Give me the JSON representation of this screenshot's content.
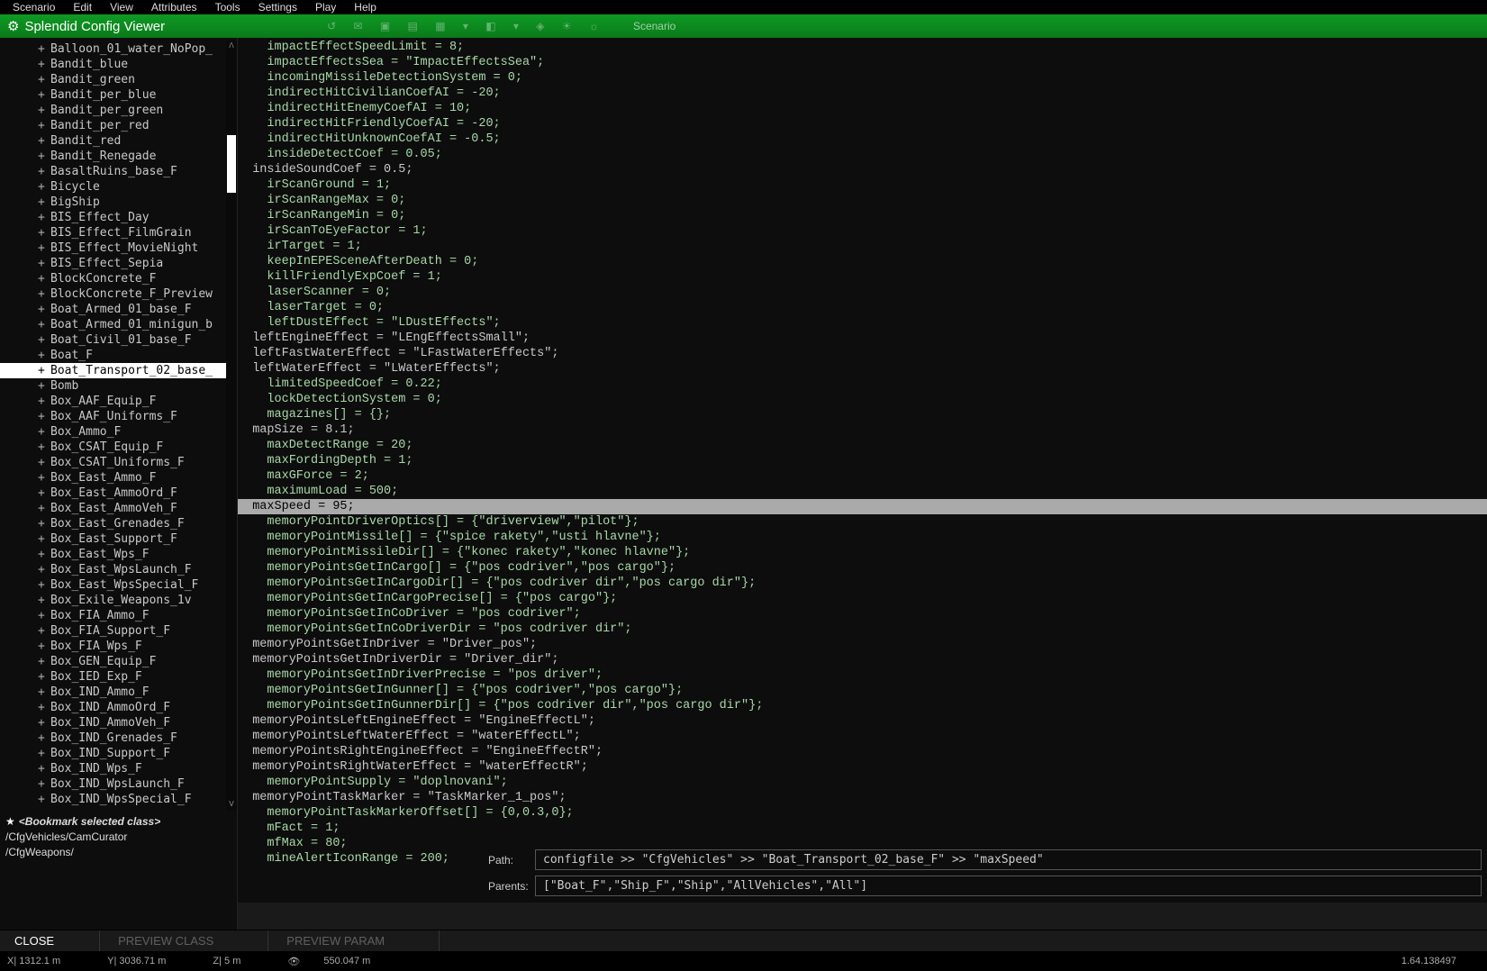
{
  "menu": [
    "Scenario",
    "Edit",
    "View",
    "Attributes",
    "Tools",
    "Settings",
    "Play",
    "Help"
  ],
  "window_title": "Splendid Config Viewer",
  "scenario_label": "Scenario",
  "tree": [
    {
      "label": "Balloon_01_water_NoPop_"
    },
    {
      "label": "Bandit_blue"
    },
    {
      "label": "Bandit_green"
    },
    {
      "label": "Bandit_per_blue"
    },
    {
      "label": "Bandit_per_green"
    },
    {
      "label": "Bandit_per_red"
    },
    {
      "label": "Bandit_red"
    },
    {
      "label": "Bandit_Renegade"
    },
    {
      "label": "BasaltRuins_base_F"
    },
    {
      "label": "Bicycle"
    },
    {
      "label": "BigShip"
    },
    {
      "label": "BIS_Effect_Day"
    },
    {
      "label": "BIS_Effect_FilmGrain"
    },
    {
      "label": "BIS_Effect_MovieNight"
    },
    {
      "label": "BIS_Effect_Sepia"
    },
    {
      "label": "BlockConcrete_F"
    },
    {
      "label": "BlockConcrete_F_Preview"
    },
    {
      "label": "Boat_Armed_01_base_F"
    },
    {
      "label": "Boat_Armed_01_minigun_b"
    },
    {
      "label": "Boat_Civil_01_base_F"
    },
    {
      "label": "Boat_F"
    },
    {
      "label": "Boat_Transport_02_base_",
      "selected": true
    },
    {
      "label": "Bomb"
    },
    {
      "label": "Box_AAF_Equip_F"
    },
    {
      "label": "Box_AAF_Uniforms_F"
    },
    {
      "label": "Box_Ammo_F"
    },
    {
      "label": "Box_CSAT_Equip_F"
    },
    {
      "label": "Box_CSAT_Uniforms_F"
    },
    {
      "label": "Box_East_Ammo_F"
    },
    {
      "label": "Box_East_AmmoOrd_F"
    },
    {
      "label": "Box_East_AmmoVeh_F"
    },
    {
      "label": "Box_East_Grenades_F"
    },
    {
      "label": "Box_East_Support_F"
    },
    {
      "label": "Box_East_Wps_F"
    },
    {
      "label": "Box_East_WpsLaunch_F"
    },
    {
      "label": "Box_East_WpsSpecial_F"
    },
    {
      "label": "Box_Exile_Weapons_1v"
    },
    {
      "label": "Box_FIA_Ammo_F"
    },
    {
      "label": "Box_FIA_Support_F"
    },
    {
      "label": "Box_FIA_Wps_F"
    },
    {
      "label": "Box_GEN_Equip_F"
    },
    {
      "label": "Box_IED_Exp_F"
    },
    {
      "label": "Box_IND_Ammo_F"
    },
    {
      "label": "Box_IND_AmmoOrd_F"
    },
    {
      "label": "Box_IND_AmmoVeh_F"
    },
    {
      "label": "Box_IND_Grenades_F"
    },
    {
      "label": "Box_IND_Support_F"
    },
    {
      "label": "Box_IND_Wps_F"
    },
    {
      "label": "Box_IND_WpsLaunch_F"
    },
    {
      "label": "Box_IND_WpsSpecial_F"
    }
  ],
  "bookmarks": {
    "title": "<Bookmark selected class>",
    "items": [
      "/CfgVehicles/CamCurator",
      "/CfgWeapons/"
    ]
  },
  "code": [
    {
      "indent": 2,
      "inh": true,
      "text": "impactEffectSpeedLimit = 8;"
    },
    {
      "indent": 2,
      "inh": true,
      "text": "impactEffectsSea = \"ImpactEffectsSea\";"
    },
    {
      "indent": 2,
      "inh": true,
      "text": "incomingMissileDetectionSystem = 0;"
    },
    {
      "indent": 2,
      "inh": true,
      "text": "indirectHitCivilianCoefAI = -20;"
    },
    {
      "indent": 2,
      "inh": true,
      "text": "indirectHitEnemyCoefAI = 10;"
    },
    {
      "indent": 2,
      "inh": true,
      "text": "indirectHitFriendlyCoefAI = -20;"
    },
    {
      "indent": 2,
      "inh": true,
      "text": "indirectHitUnknownCoefAI = -0.5;"
    },
    {
      "indent": 2,
      "inh": true,
      "text": "insideDetectCoef = 0.05;"
    },
    {
      "indent": 1,
      "inh": false,
      "text": "insideSoundCoef = 0.5;"
    },
    {
      "indent": 2,
      "inh": true,
      "text": "irScanGround = 1;"
    },
    {
      "indent": 2,
      "inh": true,
      "text": "irScanRangeMax = 0;"
    },
    {
      "indent": 2,
      "inh": true,
      "text": "irScanRangeMin = 0;"
    },
    {
      "indent": 2,
      "inh": true,
      "text": "irScanToEyeFactor = 1;"
    },
    {
      "indent": 2,
      "inh": true,
      "text": "irTarget = 1;"
    },
    {
      "indent": 2,
      "inh": true,
      "text": "keepInEPESceneAfterDeath = 0;"
    },
    {
      "indent": 2,
      "inh": true,
      "text": "killFriendlyExpCoef = 1;"
    },
    {
      "indent": 2,
      "inh": true,
      "text": "laserScanner = 0;"
    },
    {
      "indent": 2,
      "inh": true,
      "text": "laserTarget = 0;"
    },
    {
      "indent": 2,
      "inh": true,
      "text": "leftDustEffect = \"LDustEffects\";"
    },
    {
      "indent": 1,
      "inh": false,
      "text": "leftEngineEffect = \"LEngEffectsSmall\";"
    },
    {
      "indent": 1,
      "inh": false,
      "text": "leftFastWaterEffect = \"LFastWaterEffects\";"
    },
    {
      "indent": 1,
      "inh": false,
      "text": "leftWaterEffect = \"LWaterEffects\";"
    },
    {
      "indent": 2,
      "inh": true,
      "text": "limitedSpeedCoef = 0.22;"
    },
    {
      "indent": 2,
      "inh": true,
      "text": "lockDetectionSystem = 0;"
    },
    {
      "indent": 2,
      "inh": true,
      "text": "magazines[] = {};"
    },
    {
      "indent": 1,
      "inh": false,
      "text": "mapSize = 8.1;"
    },
    {
      "indent": 2,
      "inh": true,
      "text": "maxDetectRange = 20;"
    },
    {
      "indent": 2,
      "inh": true,
      "text": "maxFordingDepth = 1;"
    },
    {
      "indent": 2,
      "inh": true,
      "text": "maxGForce = 2;"
    },
    {
      "indent": 2,
      "inh": true,
      "text": "maximumLoad = 500;"
    },
    {
      "indent": 1,
      "inh": false,
      "text": "maxSpeed = 95;",
      "selected": true
    },
    {
      "indent": 2,
      "inh": true,
      "text": "memoryPointDriverOptics[] = {\"driverview\",\"pilot\"};"
    },
    {
      "indent": 2,
      "inh": true,
      "text": "memoryPointMissile[] = {\"spice rakety\",\"usti hlavne\"};"
    },
    {
      "indent": 2,
      "inh": true,
      "text": "memoryPointMissileDir[] = {\"konec rakety\",\"konec hlavne\"};"
    },
    {
      "indent": 2,
      "inh": true,
      "text": "memoryPointsGetInCargo[] = {\"pos codriver\",\"pos cargo\"};"
    },
    {
      "indent": 2,
      "inh": true,
      "text": "memoryPointsGetInCargoDir[] = {\"pos codriver dir\",\"pos cargo dir\"};"
    },
    {
      "indent": 2,
      "inh": true,
      "text": "memoryPointsGetInCargoPrecise[] = {\"pos cargo\"};"
    },
    {
      "indent": 2,
      "inh": true,
      "text": "memoryPointsGetInCoDriver = \"pos codriver\";"
    },
    {
      "indent": 2,
      "inh": true,
      "text": "memoryPointsGetInCoDriverDir = \"pos codriver dir\";"
    },
    {
      "indent": 1,
      "inh": false,
      "text": "memoryPointsGetInDriver = \"Driver_pos\";"
    },
    {
      "indent": 1,
      "inh": false,
      "text": "memoryPointsGetInDriverDir = \"Driver_dir\";"
    },
    {
      "indent": 2,
      "inh": true,
      "text": "memoryPointsGetInDriverPrecise = \"pos driver\";"
    },
    {
      "indent": 2,
      "inh": true,
      "text": "memoryPointsGetInGunner[] = {\"pos codriver\",\"pos cargo\"};"
    },
    {
      "indent": 2,
      "inh": true,
      "text": "memoryPointsGetInGunnerDir[] = {\"pos codriver dir\",\"pos cargo dir\"};"
    },
    {
      "indent": 1,
      "inh": false,
      "text": "memoryPointsLeftEngineEffect = \"EngineEffectL\";"
    },
    {
      "indent": 1,
      "inh": false,
      "text": "memoryPointsLeftWaterEffect = \"waterEffectL\";"
    },
    {
      "indent": 1,
      "inh": false,
      "text": "memoryPointsRightEngineEffect = \"EngineEffectR\";"
    },
    {
      "indent": 1,
      "inh": false,
      "text": "memoryPointsRightWaterEffect = \"waterEffectR\";"
    },
    {
      "indent": 2,
      "inh": true,
      "text": "memoryPointSupply = \"doplnovani\";"
    },
    {
      "indent": 1,
      "inh": false,
      "text": "memoryPointTaskMarker = \"TaskMarker_1_pos\";"
    },
    {
      "indent": 2,
      "inh": true,
      "text": "memoryPointTaskMarkerOffset[] = {0,0.3,0};"
    },
    {
      "indent": 2,
      "inh": true,
      "text": "mFact = 1;"
    },
    {
      "indent": 2,
      "inh": true,
      "text": "mfMax = 80;"
    },
    {
      "indent": 2,
      "inh": true,
      "text": "mineAlertIconRange = 200;"
    }
  ],
  "footer": {
    "path_label": "Path:",
    "path_value": "configfile >> \"CfgVehicles\" >> \"Boat_Transport_02_base_F\" >> \"maxSpeed\"",
    "parents_label": "Parents:",
    "parents_value": "[\"Boat_F\",\"Ship_F\",\"Ship\",\"AllVehicles\",\"All\"]"
  },
  "buttons": {
    "close": "CLOSE",
    "preview_class": "PREVIEW CLASS",
    "preview_param": "PREVIEW PARAM"
  },
  "status": {
    "x": "1312.1 m",
    "y": "3036.71 m",
    "z": "5 m",
    "dist": "550.047 m",
    "right": "1.64.138497"
  }
}
